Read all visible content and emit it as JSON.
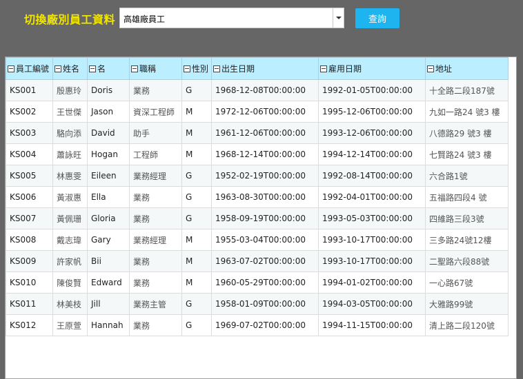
{
  "toolbar": {
    "label": "切換廠別員工資料",
    "select_value": "高雄廠員工",
    "query_label": "查詢"
  },
  "colors": {
    "accent": "#1eb4f0",
    "label": "#f2e600",
    "header": "#bbeeff",
    "background": "#666666"
  },
  "grid": {
    "columns": [
      "員工編號",
      "姓名",
      "名",
      "職稱",
      "性別",
      "出生日期",
      "雇用日期",
      "地址"
    ],
    "rows": [
      [
        "KS001",
        "殷惠玲",
        "Doris",
        "業務",
        "G",
        "1968-12-08T00:00:00",
        "1992-01-05T00:00:00",
        "十全路二段187號"
      ],
      [
        "KS002",
        "王世傑",
        "Jason",
        "資深工程師",
        "M",
        "1972-12-06T00:00:00",
        "1995-12-06T00:00:00",
        "九如一路24 號3 樓"
      ],
      [
        "KS003",
        "駱向添",
        "David",
        "助手",
        "M",
        "1961-12-06T00:00:00",
        "1993-12-06T00:00:00",
        "八德路29 號3 樓"
      ],
      [
        "KS004",
        "蕭詠旺",
        "Hogan",
        "工程師",
        "M",
        "1968-12-14T00:00:00",
        "1994-12-14T00:00:00",
        "七賢路24 號3 樓"
      ],
      [
        "KS005",
        "林惠雯",
        "Eileen",
        "業務經理",
        "G",
        "1952-02-19T00:00:00",
        "1992-08-14T00:00:00",
        "六合路1號"
      ],
      [
        "KS006",
        "黃淑惠",
        "Ella",
        "業務",
        "G",
        "1963-08-30T00:00:00",
        "1992-04-01T00:00:00",
        "五福路四段4 號"
      ],
      [
        "KS007",
        "黃佩珊",
        "Gloria",
        "業務",
        "G",
        "1958-09-19T00:00:00",
        "1993-05-03T00:00:00",
        "四維路三段3號"
      ],
      [
        "KS008",
        "戴志瑋",
        "Gary",
        "業務經理",
        "M",
        "1955-03-04T00:00:00",
        "1993-10-17T00:00:00",
        "三多路24號12樓"
      ],
      [
        "KS009",
        "許家帆",
        "Bii",
        "業務",
        "M",
        "1963-07-02T00:00:00",
        "1993-10-17T00:00:00",
        "二聖路六段88號"
      ],
      [
        "KS010",
        "陳俊賢",
        "Edward",
        "業務",
        "M",
        "1960-05-29T00:00:00",
        "1994-01-02T00:00:00",
        "一心路67號"
      ],
      [
        "KS011",
        "林美枝",
        "Jill",
        "業務主管",
        "G",
        "1958-01-09T00:00:00",
        "1994-03-05T00:00:00",
        "大雅路99號"
      ],
      [
        "KS012",
        "王原萱",
        "Hannah",
        "業務",
        "G",
        "1969-07-02T00:00:00",
        "1994-11-15T00:00:00",
        "清上路二段120號"
      ]
    ]
  }
}
